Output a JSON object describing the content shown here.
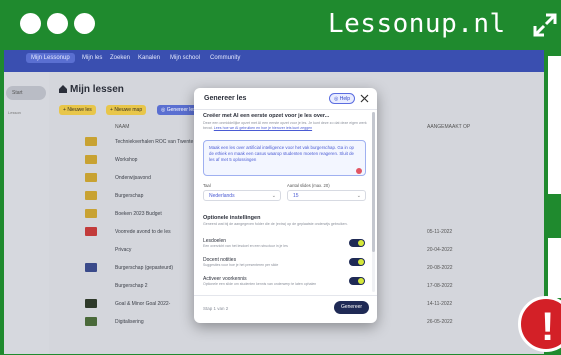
{
  "frame": {
    "title": "Lessonup.nl",
    "colors": {
      "frame": "#1f8a2e",
      "alert": "#d32027"
    },
    "icons": {
      "expand": "expand-arrows-icon",
      "alert": "exclamation-icon"
    }
  },
  "nav": {
    "items": [
      "Mijn Lessonup",
      "Mijn les",
      "Zoeken",
      "Kanalen",
      "Mijn school",
      "Community"
    ]
  },
  "sidebar": {
    "top_label": "Start",
    "items": [
      "Lesson"
    ]
  },
  "main": {
    "title": "Mijn lessen",
    "buttons": {
      "new_lesson": "Nieuwe les",
      "new_folder": "Nieuwe map",
      "generate": "Genereer les"
    },
    "columns": {
      "name": "NAAM",
      "created": "AANGEMAAKT OP"
    },
    "rows": [
      {
        "name": "Techniekverhalen ROC van Twente",
        "date": ""
      },
      {
        "name": "Workshop",
        "date": ""
      },
      {
        "name": "Onderwijsavond",
        "date": ""
      },
      {
        "name": "Burgerschap",
        "date": ""
      },
      {
        "name": "Boeken 2023 Budget",
        "date": ""
      },
      {
        "name": "Voorrede avond to de les",
        "date": "05-11-2022"
      },
      {
        "name": "Privacy",
        "date": "20-04-2022"
      },
      {
        "name": "Burgerschap (gepasteurd)",
        "date": "20-08-2022"
      },
      {
        "name": "Burgerschap 2",
        "date": "17-08-2022"
      },
      {
        "name": "Goal & Minor Goal 2022-",
        "date": "14-11-2022"
      },
      {
        "name": "Digitalisering",
        "date": "26-05-2022"
      }
    ]
  },
  "modal": {
    "title": "Genereer les",
    "help": "Help",
    "subtitle": "Creëer met AI een eerste opzet voor je les over...",
    "desc_1": "Deze een onmiddellijke opzet met AI een eerste opzet voor je les. Je kunt deze zo dat deze eigen werk bevat.",
    "desc_link": "Lees hoe we AI gebruiken en hoe je hierover iets kunt zeggen",
    "prompt": "Maak een les over artificial intelligence voor het vak burgerschap. Ga in op de ethiek en maak een casus waarop studenten moeten reageren. Sluit de les af met 5 oplossingen",
    "fields": {
      "taal_label": "Taal",
      "taal_value": "Nederlands",
      "slides_label": "Aantal slides (max. 20)",
      "slides_value": "15"
    },
    "options_title": "Optionele instellingen",
    "options_desc": "Geneerd wat bij de aangegeven folder die de (extra) op de geplaatste onderwijs gebruiken.",
    "toggles": [
      {
        "name": "Lesdoelen",
        "desc": "Een overzicht van het lesdoel en een structuur in je les",
        "on": true
      },
      {
        "name": "Docent notities",
        "desc": "Suggesties voor hoe je het presenteren per slide",
        "on": true
      },
      {
        "name": "Activeer voorkennis",
        "desc": "Optionele een slide om studenten kennis van onderwerp te laten ophalen",
        "on": true
      }
    ],
    "step": "Stap 1 van 2",
    "submit": "Genereer"
  }
}
